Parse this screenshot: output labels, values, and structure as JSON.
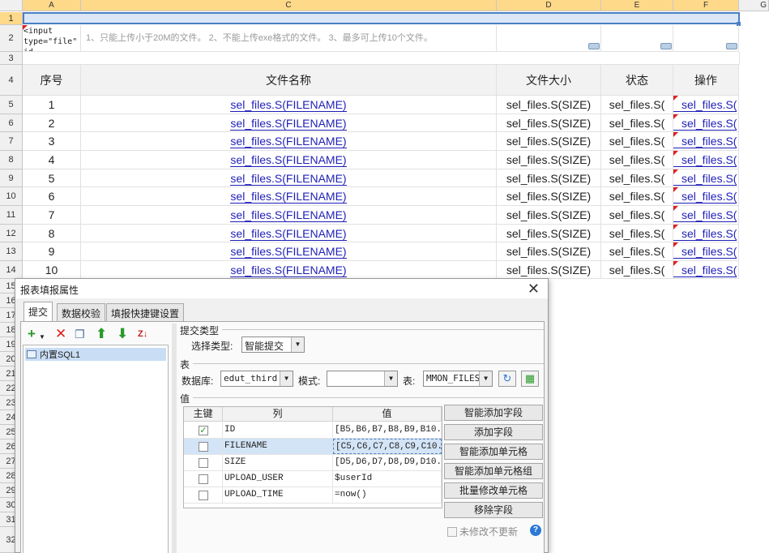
{
  "columns": [
    "A",
    "C",
    "D",
    "E",
    "F",
    "G"
  ],
  "rows": [
    "1",
    "2",
    "3",
    "4",
    "5",
    "6",
    "7",
    "8",
    "9",
    "10",
    "11",
    "12",
    "13",
    "14",
    "15",
    "16",
    "17",
    "18",
    "19",
    "20",
    "21",
    "22",
    "23",
    "24",
    "25",
    "26",
    "27",
    "28",
    "29",
    "30",
    "31",
    "32"
  ],
  "row2": {
    "a2": "<input type=\"file\" id",
    "c2": "1、只能上传小于20M的文件。  2、不能上传exe格式的文件。  3、最多可上传10个文件。"
  },
  "table_header": {
    "seq": "序号",
    "filename": "文件名称",
    "filesize": "文件大小",
    "status": "状态",
    "action": "操作"
  },
  "table_rows": [
    {
      "seq": "1",
      "name": "sel_files.S(FILENAME)",
      "size": "sel_files.S(SIZE)",
      "status": "sel_files.S(",
      "op": "sel_files.S("
    },
    {
      "seq": "2",
      "name": "sel_files.S(FILENAME)",
      "size": "sel_files.S(SIZE)",
      "status": "sel_files.S(",
      "op": "sel_files.S("
    },
    {
      "seq": "3",
      "name": "sel_files.S(FILENAME)",
      "size": "sel_files.S(SIZE)",
      "status": "sel_files.S(",
      "op": "sel_files.S("
    },
    {
      "seq": "4",
      "name": "sel_files.S(FILENAME)",
      "size": "sel_files.S(SIZE)",
      "status": "sel_files.S(",
      "op": "sel_files.S("
    },
    {
      "seq": "5",
      "name": "sel_files.S(FILENAME)",
      "size": "sel_files.S(SIZE)",
      "status": "sel_files.S(",
      "op": "sel_files.S("
    },
    {
      "seq": "6",
      "name": "sel_files.S(FILENAME)",
      "size": "sel_files.S(SIZE)",
      "status": "sel_files.S(",
      "op": "sel_files.S("
    },
    {
      "seq": "7",
      "name": "sel_files.S(FILENAME)",
      "size": "sel_files.S(SIZE)",
      "status": "sel_files.S(",
      "op": "sel_files.S("
    },
    {
      "seq": "8",
      "name": "sel_files.S(FILENAME)",
      "size": "sel_files.S(SIZE)",
      "status": "sel_files.S(",
      "op": "sel_files.S("
    },
    {
      "seq": "9",
      "name": "sel_files.S(FILENAME)",
      "size": "sel_files.S(SIZE)",
      "status": "sel_files.S(",
      "op": "sel_files.S("
    },
    {
      "seq": "10",
      "name": "sel_files.S(FILENAME)",
      "size": "sel_files.S(SIZE)",
      "status": "sel_files.S(",
      "op": "sel_files.S("
    }
  ],
  "dialog": {
    "title": "报表填报属性",
    "tabs": [
      "提交",
      "数据校验",
      "填报快捷键设置"
    ],
    "left_item": "内置SQL1",
    "submit_type_group": "提交类型",
    "select_type_label": "选择类型:",
    "select_type_value": "智能提交",
    "table_group": "表",
    "db_label": "数据库:",
    "db_value": "edut_third",
    "schema_label": "模式:",
    "schema_value": "",
    "table_label": "表:",
    "table_value": "MMON_FILES",
    "value_group": "值",
    "grid_headers": {
      "key": "主键",
      "column": "列",
      "value": "值"
    },
    "grid_rows": [
      {
        "checked": true,
        "check_mark": "✓",
        "column": "ID",
        "value": "[B5,B6,B7,B8,B9,B10..."
      },
      {
        "checked": false,
        "check_mark": "",
        "column": "FILENAME",
        "value": "[C5,C6,C7,C8,C9,C10..."
      },
      {
        "checked": false,
        "check_mark": "",
        "column": "SIZE",
        "value": "[D5,D6,D7,D8,D9,D10..."
      },
      {
        "checked": false,
        "check_mark": "",
        "column": "UPLOAD_USER",
        "value": "$userId"
      },
      {
        "checked": false,
        "check_mark": "",
        "column": "UPLOAD_TIME",
        "value": "=now()"
      }
    ],
    "buttons": [
      "智能添加字段",
      "添加字段",
      "智能添加单元格",
      "智能添加单元格组",
      "批量修改单元格",
      "移除字段"
    ],
    "no_update_label": "未修改不更新",
    "help": "?"
  },
  "icons": {
    "add": "plus-icon",
    "delete": "delete-icon",
    "copy": "copy-icon",
    "up": "arrow-up-icon",
    "down": "arrow-down-icon",
    "sort": "sort-icon",
    "refresh": "refresh-icon",
    "preview": "table-preview-icon",
    "close": "close-icon"
  },
  "colors": {
    "selected_header": "#ffd98a",
    "link": "#1f1fb8",
    "selection": "#d3e4f6"
  }
}
